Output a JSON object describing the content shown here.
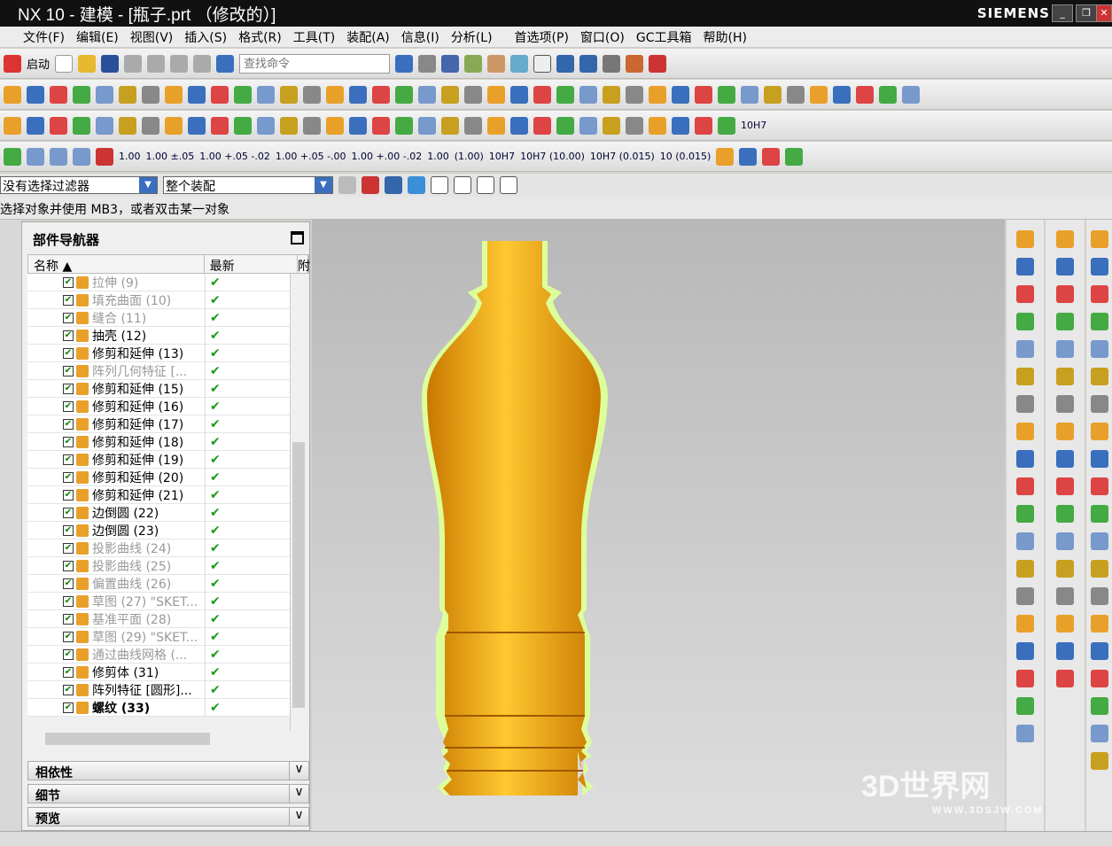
{
  "window": {
    "title": "NX 10 - 建模 - [瓶子.prt （修改的）]",
    "brand": "SIEMENS",
    "min": "_",
    "restore": "❐",
    "close": "✕"
  },
  "menu": [
    "文件(F)",
    "编辑(E)",
    "视图(V)",
    "插入(S)",
    "格式(R)",
    "工具(T)",
    "装配(A)",
    "信息(I)",
    "分析(L)",
    "首选项(P)",
    "窗口(O)",
    "GC工具箱",
    "帮助(H)"
  ],
  "toolbar": {
    "start": "启动",
    "search_placeholder": "查找命令",
    "dims": [
      "1.00",
      "1.00 ±.05",
      "1.00 +.05 -.02",
      "1.00 +.05 -.00",
      "1.00 +.00 -.02",
      "1.00",
      "(1.00)",
      "10H7",
      "10H7 (10.00)",
      "10H7 (0.015)",
      "10 (0.015)"
    ],
    "extra": "10H7"
  },
  "filter": {
    "selection_filter": "没有选择过滤器",
    "scope": "整个装配"
  },
  "status": "选择对象并使用 MB3，或者双击某一对象",
  "navigator": {
    "title": "部件导航器",
    "columns": [
      "名称",
      "最新",
      "附"
    ],
    "rows": [
      {
        "label": "拉伸 (9)",
        "dim": true
      },
      {
        "label": "填充曲面 (10)",
        "dim": true
      },
      {
        "label": "缝合 (11)",
        "dim": true
      },
      {
        "label": "抽壳 (12)"
      },
      {
        "label": "修剪和延伸 (13)"
      },
      {
        "label": "阵列几何特征 [...",
        "dim": true
      },
      {
        "label": "修剪和延伸 (15)"
      },
      {
        "label": "修剪和延伸 (16)"
      },
      {
        "label": "修剪和延伸 (17)"
      },
      {
        "label": "修剪和延伸 (18)"
      },
      {
        "label": "修剪和延伸 (19)"
      },
      {
        "label": "修剪和延伸 (20)"
      },
      {
        "label": "修剪和延伸 (21)"
      },
      {
        "label": "边倒圆 (22)"
      },
      {
        "label": "边倒圆 (23)"
      },
      {
        "label": "投影曲线 (24)",
        "dim": true
      },
      {
        "label": "投影曲线 (25)",
        "dim": true
      },
      {
        "label": "偏置曲线 (26)",
        "dim": true
      },
      {
        "label": "草图 (27) \"SKET...",
        "dim": true
      },
      {
        "label": "基准平面 (28)",
        "dim": true
      },
      {
        "label": "草图 (29) \"SKET...",
        "dim": true
      },
      {
        "label": "通过曲线网格 (...",
        "dim": true
      },
      {
        "label": "修剪体 (31)"
      },
      {
        "label": "阵列特征 [圆形]..."
      },
      {
        "label": "螺纹 (33)",
        "bold": true
      }
    ],
    "panels": [
      "相依性",
      "细节",
      "预览"
    ]
  },
  "watermark": {
    "text": "3D世界网",
    "sub": "WWW.3DSJW.COM"
  },
  "colors": {
    "bottle": "#f0a000",
    "highlight": "#ddff99",
    "check": "#1a9a1a"
  }
}
